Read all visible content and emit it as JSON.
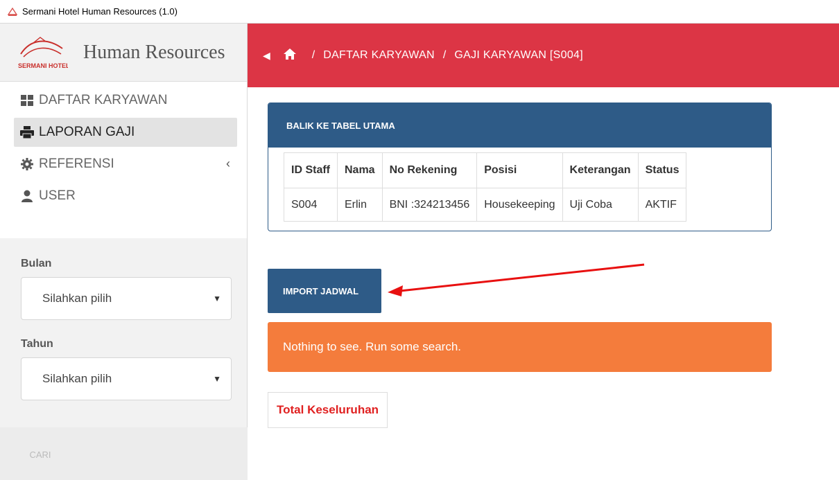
{
  "window": {
    "title": "Sermani Hotel Human Resources (1.0)"
  },
  "brand": {
    "logo_text": "SERMANI HOTEL",
    "title": "Human Resources"
  },
  "sidebar": {
    "items": [
      {
        "label": "DAFTAR KARYAWAN",
        "icon": "grid-icon"
      },
      {
        "label": "LAPORAN GAJI",
        "icon": "print-icon",
        "active": true
      },
      {
        "label": "REFERENSI",
        "icon": "gear-icon"
      },
      {
        "label": "USER",
        "icon": "user-icon"
      }
    ],
    "filters": {
      "bulan_label": "Bulan",
      "bulan_value": "Silahkan pilih",
      "tahun_label": "Tahun",
      "tahun_value": "Silahkan pilih"
    },
    "cari_label": "CARI"
  },
  "header": {
    "breadcrumb": [
      "DAFTAR KARYAWAN",
      "GAJI KARYAWAN [S004]"
    ],
    "separator": "/",
    "color": "#dc3545"
  },
  "panel": {
    "title": "BALIK KE TABEL UTAMA",
    "columns": [
      "ID Staff",
      "Nama",
      "No Rekening",
      "Posisi",
      "Keterangan",
      "Status"
    ],
    "rows": [
      [
        "S004",
        "Erlin",
        "BNI :324213456",
        "Housekeeping",
        "Uji Coba",
        "AKTIF"
      ]
    ]
  },
  "import_label": "IMPORT JADWAL",
  "alert_text": "Nothing to see. Run some search.",
  "total_label": "Total Keseluruhan"
}
